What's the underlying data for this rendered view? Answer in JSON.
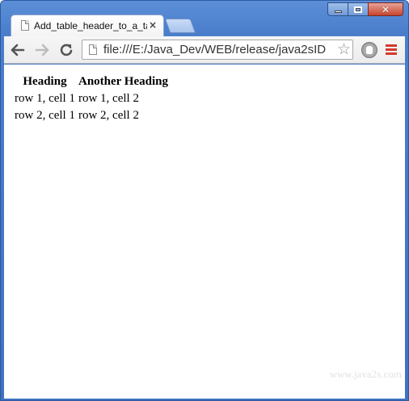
{
  "window": {
    "controls": {
      "minimize": "minimize",
      "maximize": "maximize",
      "close": "close"
    }
  },
  "tab": {
    "title": "Add_table_header_to_a_ta",
    "close_glyph": "×"
  },
  "toolbar": {
    "url": "file:///E:/Java_Dev/WEB/release/java2sID",
    "star_glyph": "☆",
    "back_glyph": "←",
    "forward_glyph": "→",
    "reload_glyph": "↻"
  },
  "table": {
    "headers": [
      "Heading",
      "Another Heading"
    ],
    "rows": [
      [
        "row 1, cell 1",
        "row 1, cell 2"
      ],
      [
        "row 2, cell 1",
        "row 2, cell 2"
      ]
    ]
  },
  "watermark": "www.java2s.com",
  "colors": {
    "window_frame": "#4a7ecb",
    "close_button": "#c8442f",
    "menu_icon": "#d23a2c"
  },
  "icons": [
    "page-icon",
    "tab-close-icon",
    "back-arrow-icon",
    "forward-arrow-icon",
    "reload-icon",
    "star-icon",
    "extension-icon",
    "menu-icon"
  ]
}
